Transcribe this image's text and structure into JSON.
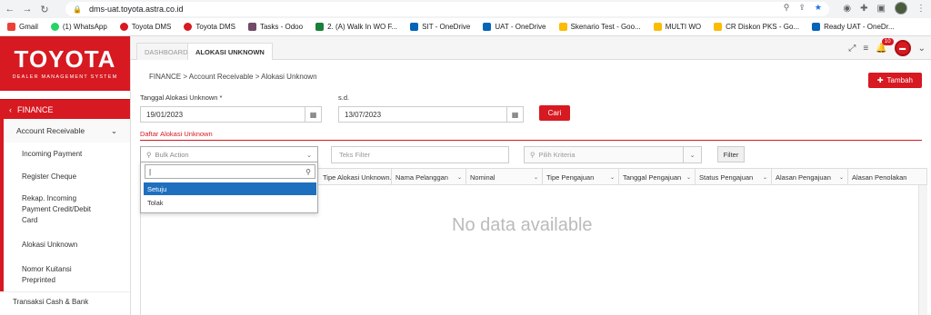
{
  "browser": {
    "url": "dms-uat.toyota.astra.co.id",
    "bookmarks": [
      "Gmail",
      "(1) WhatsApp",
      "Toyota DMS",
      "Toyota DMS",
      "Tasks - Odoo",
      "2. (A) Walk In WO F...",
      "SIT - OneDrive",
      "UAT - OneDrive",
      "Skenario Test - Goo...",
      "MULTI WO",
      "CR Diskon PKS - Go...",
      "Ready UAT - OneDr..."
    ]
  },
  "brand": {
    "logo": "TOYOTA",
    "subtitle": "DEALER MANAGEMENT SYSTEM"
  },
  "sidebar": {
    "module": "FINANCE",
    "group": "Account Receivable",
    "items": [
      "Incoming Payment",
      "Register Cheque",
      "Rekap. Incoming Payment Credit/Debit Card",
      "Alokasi Unknown",
      "Nomor Kuitansi Preprinted"
    ],
    "footer": "Transaksi Cash & Bank"
  },
  "tabs": [
    "DASHBOARD",
    "ALOKASI UNKNOWN"
  ],
  "notifications": {
    "count": "10"
  },
  "main": {
    "breadcrumb": "FINANCE > Account Receivable > Alokasi Unknown",
    "add_label": "Tambah",
    "date_from_label": "Tanggal Alokasi Unknown *",
    "date_from": "19/01/2023",
    "date_to_label": "s.d.",
    "date_to": "13/07/2023",
    "search_label": "Cari",
    "section_title": "Daftar Alokasi Unknown",
    "bulk_placeholder": "Bulk Action",
    "text_filter_placeholder": "Teks Filter",
    "criteria_placeholder": "Pilih Kriteria",
    "filter_label": "Filter",
    "columns": [
      "Tipe Alokasi Unknown...",
      "Nama Pelanggan",
      "Nominal",
      "Tipe Pengajuan",
      "Tanggal Pengajuan",
      "Status Pengajuan",
      "Alasan Pengajuan",
      "Alasan Penolakan"
    ],
    "no_data": "No data available",
    "dropdown_options": [
      "Setuju",
      "Tolak"
    ]
  },
  "colors": {
    "brand_red": "#d71921",
    "selected_blue": "#1f6fbf"
  }
}
